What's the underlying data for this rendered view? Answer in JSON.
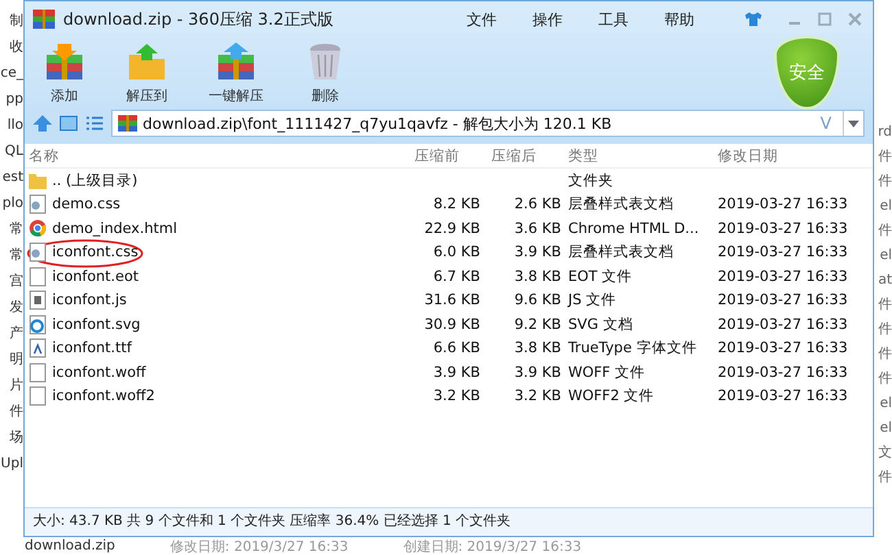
{
  "background_left": [
    "制",
    "收",
    "ce_",
    "pp",
    "llo",
    "QL",
    "est",
    "plo",
    "常",
    "常",
    "宫",
    "发",
    "产",
    "明",
    "片",
    "件",
    "场",
    "Upl"
  ],
  "background_right": [
    "rd",
    "件",
    "件",
    "el",
    "件",
    "el",
    "at",
    "件",
    "件",
    "件",
    "件",
    "el",
    "el",
    "文",
    "件"
  ],
  "background_bottom": [
    "download.zip",
    "修改日期: 2019/3/27 16:33",
    "创建日期: 2019/3/27 16:33"
  ],
  "window": {
    "title": "download.zip - 360压缩 3.2正式版",
    "menu": [
      "文件",
      "操作",
      "工具",
      "帮助"
    ]
  },
  "toolbar": [
    {
      "label": "添加",
      "kind": "add"
    },
    {
      "label": "解压到",
      "kind": "extract"
    },
    {
      "label": "一键解压",
      "kind": "quick"
    },
    {
      "label": "删除",
      "kind": "delete"
    }
  ],
  "security_badge": "安全",
  "address": {
    "value": "download.zip\\font_1111427_q7yu1qavfz - 解包大小为 120.1 KB",
    "history_button": "V"
  },
  "table": {
    "columns": [
      "名称",
      "压缩前",
      "压缩后",
      "类型",
      "修改日期"
    ],
    "rows": [
      {
        "name": ".. (上级目录)",
        "kind": "folder",
        "size": "",
        "packed": "",
        "type": "文件夹",
        "modified": "",
        "marked": false
      },
      {
        "name": "demo.css",
        "kind": "css",
        "size": "8.2 KB",
        "packed": "2.6 KB",
        "type": "层叠样式表文档",
        "modified": "2019-03-27 16:33",
        "marked": false
      },
      {
        "name": "demo_index.html",
        "kind": "chrome",
        "size": "22.9 KB",
        "packed": "3.6 KB",
        "type": "Chrome HTML D...",
        "modified": "2019-03-27 16:33",
        "marked": false
      },
      {
        "name": "iconfont.css",
        "kind": "css",
        "size": "6.0 KB",
        "packed": "3.9 KB",
        "type": "层叠样式表文档",
        "modified": "2019-03-27 16:33",
        "marked": true
      },
      {
        "name": "iconfont.eot",
        "kind": "file",
        "size": "6.7 KB",
        "packed": "3.8 KB",
        "type": "EOT 文件",
        "modified": "2019-03-27 16:33",
        "marked": false
      },
      {
        "name": "iconfont.js",
        "kind": "script",
        "size": "31.6 KB",
        "packed": "9.6 KB",
        "type": "JS 文件",
        "modified": "2019-03-27 16:33",
        "marked": false
      },
      {
        "name": "iconfont.svg",
        "kind": "web",
        "size": "30.9 KB",
        "packed": "9.2 KB",
        "type": "SVG 文档",
        "modified": "2019-03-27 16:33",
        "marked": false
      },
      {
        "name": "iconfont.ttf",
        "kind": "font",
        "size": "6.6 KB",
        "packed": "3.8 KB",
        "type": "TrueType 字体文件",
        "modified": "2019-03-27 16:33",
        "marked": false
      },
      {
        "name": "iconfont.woff",
        "kind": "file",
        "size": "3.9 KB",
        "packed": "3.9 KB",
        "type": "WOFF 文件",
        "modified": "2019-03-27 16:33",
        "marked": false
      },
      {
        "name": "iconfont.woff2",
        "kind": "file",
        "size": "3.2 KB",
        "packed": "3.2 KB",
        "type": "WOFF2 文件",
        "modified": "2019-03-27 16:33",
        "marked": false
      }
    ]
  },
  "status_bar": "大小: 43.7 KB 共 9 个文件和 1 个文件夹 压缩率 36.4% 已经选择 1 个文件夹"
}
